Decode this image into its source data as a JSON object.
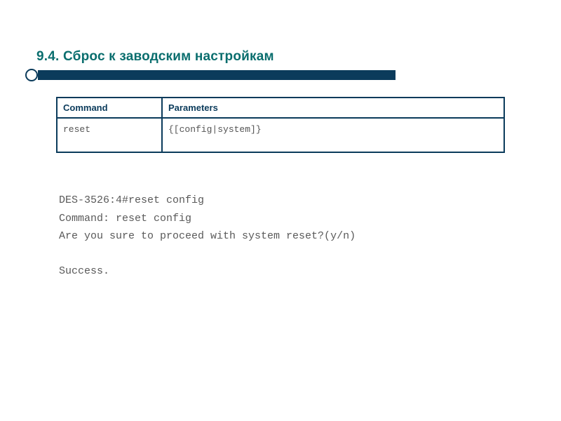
{
  "title": "9.4. Сброс к заводским настройкам",
  "table": {
    "header_command": "Command",
    "header_parameters": "Parameters",
    "row_command": "reset",
    "row_parameters": "{[config|system]}"
  },
  "terminal": {
    "line1": "DES-3526:4#reset config",
    "line2": "Command: reset config",
    "line3": "Are you sure to proceed with system reset?(y/n)",
    "line4": "Success."
  }
}
